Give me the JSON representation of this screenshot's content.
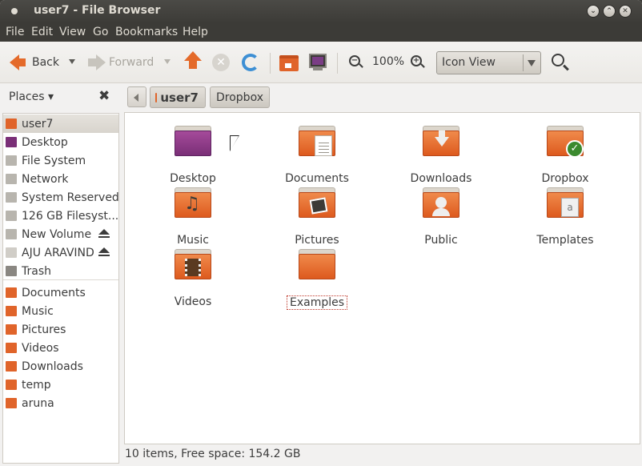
{
  "window": {
    "title": "user7 - File Browser"
  },
  "menu": [
    "File",
    "Edit",
    "View",
    "Go",
    "Bookmarks",
    "Help"
  ],
  "toolbar": {
    "back_label": "Back",
    "forward_label": "Forward",
    "zoom_level": "100%",
    "view_mode": "Icon View",
    "icons": [
      "back-arrow-icon",
      "forward-arrow-icon",
      "up-arrow-icon",
      "stop-icon",
      "reload-icon",
      "home-folder-icon",
      "computer-icon",
      "zoom-out-icon",
      "zoom-in-icon",
      "search-icon"
    ]
  },
  "sidebar": {
    "header": "Places",
    "close_glyph": "✖",
    "items": [
      {
        "label": "user7",
        "icon": "home-folder-icon",
        "color": "#e0642a",
        "selected": true,
        "eject": false
      },
      {
        "label": "Desktop",
        "icon": "desktop-icon",
        "color": "#7a2f77",
        "selected": false,
        "eject": false
      },
      {
        "label": "File System",
        "icon": "drive-icon",
        "color": "#b8b5ae",
        "selected": false,
        "eject": false
      },
      {
        "label": "Network",
        "icon": "network-icon",
        "color": "#b8b5ae",
        "selected": false,
        "eject": false
      },
      {
        "label": "System Reserved",
        "icon": "drive-icon",
        "color": "#b8b5ae",
        "selected": false,
        "eject": false
      },
      {
        "label": "126 GB Filesyst...",
        "icon": "drive-icon",
        "color": "#b8b5ae",
        "selected": false,
        "eject": false
      },
      {
        "label": "New Volume",
        "icon": "drive-icon",
        "color": "#b8b5ae",
        "selected": false,
        "eject": true
      },
      {
        "label": "AJU ARAVIND",
        "icon": "cd-icon",
        "color": "#d0cdc7",
        "selected": false,
        "eject": true
      },
      {
        "label": "Trash",
        "icon": "trash-icon",
        "color": "#8a8782",
        "selected": false,
        "eject": false
      }
    ],
    "bookmarks": [
      {
        "label": "Documents",
        "icon": "documents-folder-icon",
        "color": "#e0642a"
      },
      {
        "label": "Music",
        "icon": "music-folder-icon",
        "color": "#e0642a"
      },
      {
        "label": "Pictures",
        "icon": "pictures-folder-icon",
        "color": "#e0642a"
      },
      {
        "label": "Videos",
        "icon": "videos-folder-icon",
        "color": "#e0642a"
      },
      {
        "label": "Downloads",
        "icon": "downloads-folder-icon",
        "color": "#e0642a"
      },
      {
        "label": "temp",
        "icon": "folder-icon",
        "color": "#e0642a"
      },
      {
        "label": "aruna",
        "icon": "folder-icon",
        "color": "#e0642a"
      }
    ]
  },
  "pathbar": {
    "segments": [
      "user7",
      "Dropbox"
    ]
  },
  "files": [
    {
      "label": "Desktop",
      "icon": "desktop-folder-icon"
    },
    {
      "label": "Documents",
      "icon": "documents-folder-icon"
    },
    {
      "label": "Downloads",
      "icon": "downloads-folder-icon"
    },
    {
      "label": "Dropbox",
      "icon": "dropbox-folder-icon"
    },
    {
      "label": "Music",
      "icon": "music-folder-icon"
    },
    {
      "label": "Pictures",
      "icon": "pictures-folder-icon"
    },
    {
      "label": "Public",
      "icon": "public-folder-icon"
    },
    {
      "label": "Templates",
      "icon": "templates-folder-icon"
    },
    {
      "label": "Videos",
      "icon": "videos-folder-icon"
    },
    {
      "label": "Examples",
      "icon": "examples-folder-icon"
    }
  ],
  "status": {
    "text": "10 items, Free space: 154.2 GB"
  },
  "colors": {
    "accent": "#e0642a",
    "titlebar": "#3c3b37",
    "title_text": "#dfdbd2"
  }
}
